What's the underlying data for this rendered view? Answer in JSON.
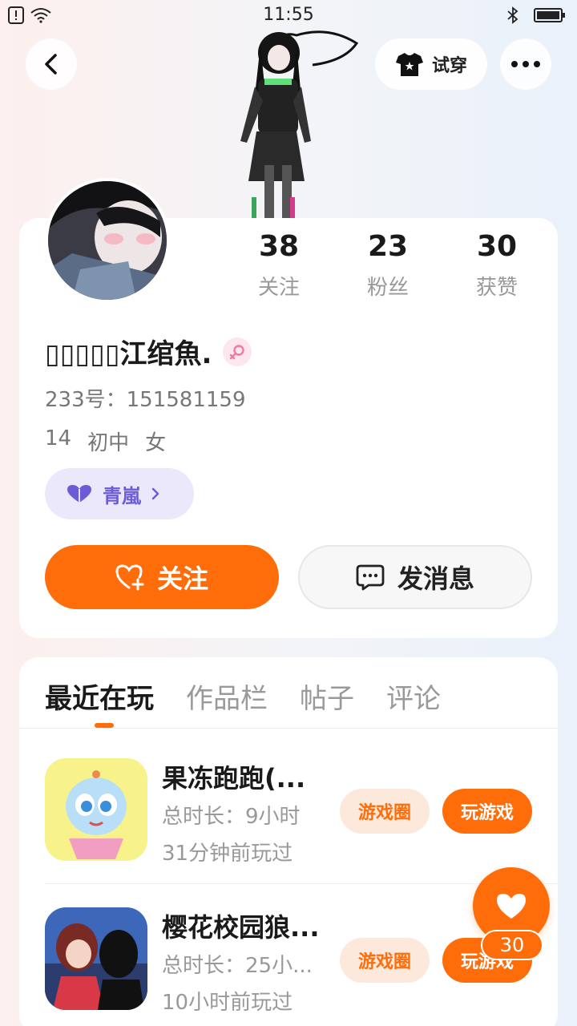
{
  "status_bar": {
    "time": "11:55"
  },
  "header": {
    "try_on_label": "试穿"
  },
  "profile": {
    "stats": [
      {
        "value": "38",
        "label": "关注"
      },
      {
        "value": "23",
        "label": "粉丝"
      },
      {
        "value": "30",
        "label": "获赞"
      }
    ],
    "username": "▯▯▯▯▯江绾魚.",
    "id_text": "233号：151581159",
    "age": "14",
    "grade": "初中",
    "gender": "女",
    "guild_name": "青嵐",
    "follow_label": "关注",
    "message_label": "发消息"
  },
  "tabs": [
    {
      "label": "最近在玩",
      "active": true
    },
    {
      "label": "作品栏",
      "active": false
    },
    {
      "label": "帖子",
      "active": false
    },
    {
      "label": "评论",
      "active": false
    }
  ],
  "games": [
    {
      "title": "果冻跑跑(...",
      "duration": "总时长：9小时",
      "last_played": "31分钟前玩过",
      "circle_label": "游戏圈",
      "play_label": "玩游戏"
    },
    {
      "title": "樱花校园狼...",
      "duration": "总时长：25小...",
      "last_played": "10小时前玩过",
      "circle_label": "游戏圈",
      "play_label": "玩游戏"
    }
  ],
  "like_count": "30",
  "colors": {
    "accent": "#ff6d0a",
    "guild": "#6a5bd9"
  },
  "icons": [
    "notification-icon",
    "wifi-icon",
    "bluetooth-icon",
    "battery-icon",
    "back-icon",
    "tshirt-icon",
    "more-icon",
    "female-icon",
    "heart-icon",
    "add-heart-icon",
    "chat-icon",
    "chevron-right-icon"
  ]
}
